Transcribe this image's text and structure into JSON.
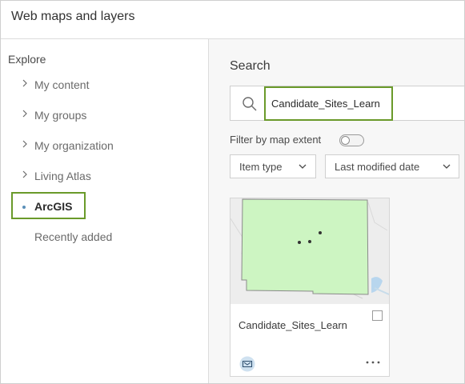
{
  "header": {
    "title": "Web maps and layers"
  },
  "sidebar": {
    "heading": "Explore",
    "items": [
      {
        "label": "My content"
      },
      {
        "label": "My groups"
      },
      {
        "label": "My organization"
      },
      {
        "label": "Living Atlas"
      },
      {
        "label": "ArcGIS",
        "selected": true
      },
      {
        "label": "Recently added"
      }
    ]
  },
  "main": {
    "search_heading": "Search",
    "search_value": "Candidate_Sites_Learn",
    "filter_label": "Filter by map extent",
    "filter_toggle_on": false,
    "dropdowns": [
      {
        "label": "Item type"
      },
      {
        "label": "Last modified date"
      }
    ],
    "results": [
      {
        "title": "Candidate_Sites_Learn",
        "icon": "map-layer-icon",
        "checked": false
      }
    ]
  },
  "colors": {
    "highlight": "#6a9a2a",
    "polygon_fill": "#cdf5c2",
    "selected_dot": "#5a8fb8"
  }
}
